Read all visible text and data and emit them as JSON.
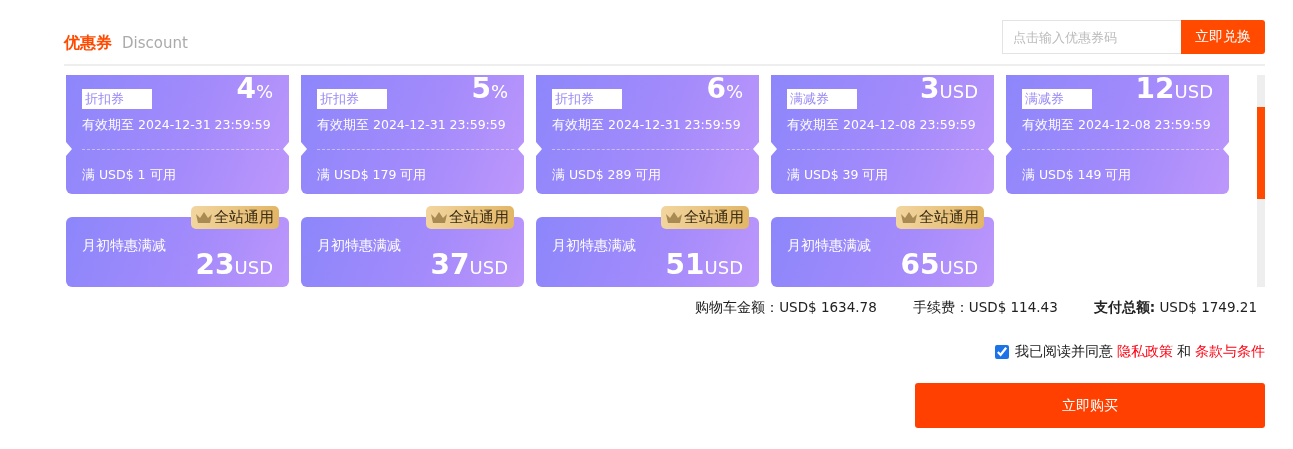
{
  "header": {
    "title": "优惠券",
    "subtitle": "Discount",
    "code_field": {
      "placeholder": "点击输入优惠券码"
    },
    "redeem_button": "立即兑换"
  },
  "coupon_rows": [
    {
      "kind": "detail",
      "items": [
        {
          "tag": "折扣券",
          "amount": "4",
          "unit": "%",
          "expiry": "有效期至 2024-12-31 23:59:59",
          "condition": "满 USD$ 1 可用"
        },
        {
          "tag": "折扣券",
          "amount": "5",
          "unit": "%",
          "expiry": "有效期至 2024-12-31 23:59:59",
          "condition": "满 USD$ 179 可用"
        },
        {
          "tag": "折扣券",
          "amount": "6",
          "unit": "%",
          "expiry": "有效期至 2024-12-31 23:59:59",
          "condition": "满 USD$ 289 可用"
        },
        {
          "tag": "满减券",
          "amount": "3",
          "unit": "USD",
          "expiry": "有效期至 2024-12-08 23:59:59",
          "condition": "满 USD$ 39 可用"
        },
        {
          "tag": "满减券",
          "amount": "12",
          "unit": "USD",
          "expiry": "有效期至 2024-12-08 23:59:59",
          "condition": "满 USD$ 149 可用"
        }
      ]
    },
    {
      "kind": "titled",
      "items": [
        {
          "badge": "全站通用",
          "title": "月初特惠满减",
          "amount": "23",
          "unit": "USD"
        },
        {
          "badge": "全站通用",
          "title": "月初特惠满减",
          "amount": "37",
          "unit": "USD"
        },
        {
          "badge": "全站通用",
          "title": "月初特惠满减",
          "amount": "51",
          "unit": "USD"
        },
        {
          "badge": "全站通用",
          "title": "月初特惠满减",
          "amount": "65",
          "unit": "USD"
        }
      ]
    }
  ],
  "summary": [
    {
      "label": "购物车金额：",
      "value": "USD$ 1634.78",
      "bold": false
    },
    {
      "label": "手续费：",
      "value": "USD$ 114.43",
      "bold": false
    },
    {
      "label": "支付总额:",
      "value": " USD$ 1749.21",
      "bold": true
    }
  ],
  "agreement": {
    "checked": true,
    "text": "我已阅读并同意",
    "link_1": "隐私政策",
    "joiner": "和",
    "link_2": "条款与条件"
  },
  "buy_button": "立即购买"
}
